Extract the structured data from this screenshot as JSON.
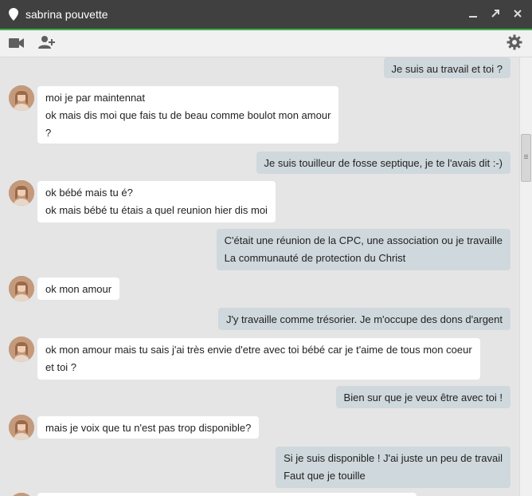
{
  "window": {
    "contact_name": "sabrina pouvette",
    "accent_color": "#3db34a",
    "titlebar_color": "#404040"
  },
  "toolbar": {
    "video_icon": "video-camera-icon",
    "add_person_icon": "add-person-icon",
    "settings_icon": "gear-icon"
  },
  "messages": [
    {
      "from": "me",
      "lines": [
        "Je suis au travail et toi ?"
      ]
    },
    {
      "from": "contact",
      "lines": [
        "moi je par maintennat",
        "ok mais dis moi que fais tu de beau comme boulot mon amour",
        "?"
      ]
    },
    {
      "from": "me",
      "lines": [
        "Je suis touilleur de fosse septique, je te l'avais dit :-)"
      ]
    },
    {
      "from": "contact",
      "lines": [
        "ok bébé mais tu é?",
        "ok mais bébé tu étais a quel reunion hier dis moi"
      ]
    },
    {
      "from": "me",
      "lines": [
        "C'était une réunion de la CPC, une association ou je travaille",
        "La communauté de protection du Christ"
      ]
    },
    {
      "from": "contact",
      "lines": [
        "ok mon amour"
      ]
    },
    {
      "from": "me",
      "lines": [
        "J'y travaille comme trésorier. Je m'occupe des dons d'argent"
      ]
    },
    {
      "from": "contact",
      "lines": [
        "ok mon amour mais tu sais j'ai très envie d'etre avec toi bébé car je t'aime de tous mon coeur",
        "et toi ?"
      ]
    },
    {
      "from": "me",
      "lines": [
        "Bien sur que je veux être avec toi !"
      ]
    },
    {
      "from": "contact",
      "lines": [
        "mais je voix que tu n'est pas trop disponible?"
      ]
    },
    {
      "from": "me",
      "lines": [
        "Si je suis disponible ! J'ai juste un peu de travail",
        "Faut que je touille"
      ]
    }
  ]
}
